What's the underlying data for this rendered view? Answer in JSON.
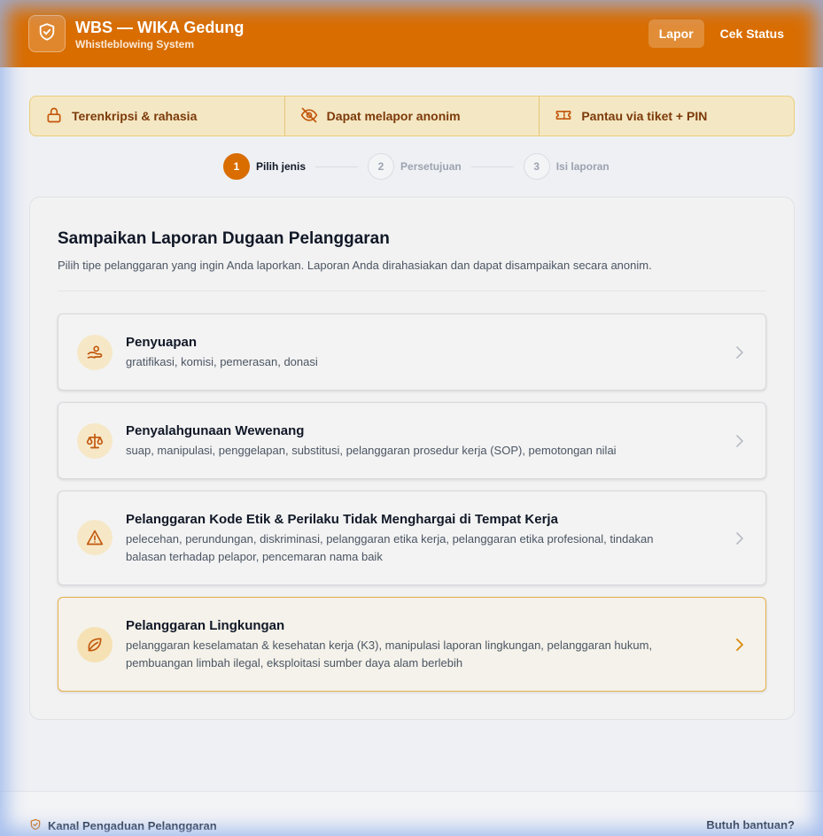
{
  "header": {
    "title": "WBS — WIKA Gedung",
    "subtitle": "Whistleblowing System",
    "logo_icon": "shield-check-icon",
    "nav": [
      {
        "label": "Lapor",
        "active": true
      },
      {
        "label": "Cek Status",
        "active": false
      }
    ]
  },
  "features": [
    {
      "label": "Terenkripsi & rahasia",
      "icon": "lock-icon"
    },
    {
      "label": "Dapat melapor anonim",
      "icon": "eye-off-icon"
    },
    {
      "label": "Pantau via tiket + PIN",
      "icon": "ticket-icon"
    }
  ],
  "steps": [
    {
      "num": "1",
      "label": "Pilih jenis",
      "active": true
    },
    {
      "num": "2",
      "label": "Persetujuan",
      "active": false
    },
    {
      "num": "3",
      "label": "Isi laporan",
      "active": false
    }
  ],
  "main": {
    "title": "Sampaikan Laporan Dugaan Pelanggaran",
    "description": "Pilih tipe pelanggaran yang ingin Anda laporkan. Laporan Anda dirahasiakan dan dapat disampaikan secara anonim.",
    "options": [
      {
        "title": "Penyuapan",
        "description": "gratifikasi, komisi, pemerasan, donasi",
        "icon": "hand-coins-icon"
      },
      {
        "title": "Penyalahgunaan Wewenang",
        "description": "suap, manipulasi, penggelapan, substitusi, pelanggaran prosedur kerja (SOP), pemotongan nilai",
        "icon": "scale-icon"
      },
      {
        "title": "Pelanggaran Kode Etik & Perilaku Tidak Menghargai di Tempat Kerja",
        "description": "pelecehan, perundungan, diskriminasi, pelanggaran etika kerja, pelanggaran etika profesional, tindakan balasan terhadap pelapor, pencemaran nama baik",
        "icon": "warning-triangle-icon"
      },
      {
        "title": "Pelanggaran Lingkungan",
        "description": "pelanggaran keselamatan & kesehatan kerja (K3), manipulasi laporan lingkungan, pelanggaran hukum, pembuangan limbah ilegal, eksploitasi sumber daya alam berlebih",
        "icon": "leaf-icon"
      }
    ]
  },
  "footer": {
    "left_label": "Kanal Pengaduan Pelanggaran",
    "right_label": "Butuh bantuan?"
  },
  "colors": {
    "brand": "#d96d00",
    "feature_bg": "#f4e7c3",
    "feature_text": "#7c3a0a",
    "highlight_border": "#e8b04c"
  }
}
